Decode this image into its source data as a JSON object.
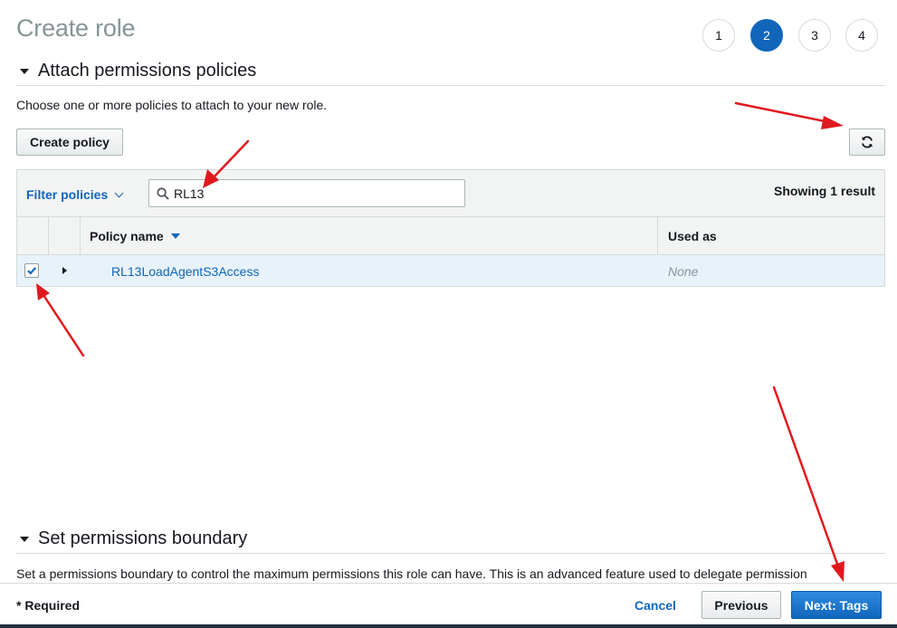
{
  "page": {
    "title": "Create role",
    "steps": [
      "1",
      "2",
      "3",
      "4"
    ],
    "active_step": "2"
  },
  "attach_section": {
    "heading": "Attach permissions policies",
    "description": "Choose one or more policies to attach to your new role.",
    "create_policy_label": "Create policy",
    "refresh_icon": "refresh-icon"
  },
  "filter": {
    "label": "Filter policies",
    "search_value": "RL13",
    "showing": "Showing 1 result"
  },
  "table": {
    "columns": [
      "Policy name",
      "Used as"
    ],
    "rows": [
      {
        "checked": true,
        "policy_name": "RL13LoadAgentS3Access",
        "used_as": "None"
      }
    ]
  },
  "boundary_section": {
    "heading": "Set permissions boundary",
    "description": "Set a permissions boundary to control the maximum permissions this role can have. This is an advanced feature used to delegate permission"
  },
  "footer": {
    "required": "* Required",
    "cancel": "Cancel",
    "previous": "Previous",
    "next": "Next: Tags"
  },
  "colors": {
    "accent": "#1166bb",
    "selected_row": "#e8f2fb",
    "annotation_arrow": "#e0191e"
  }
}
